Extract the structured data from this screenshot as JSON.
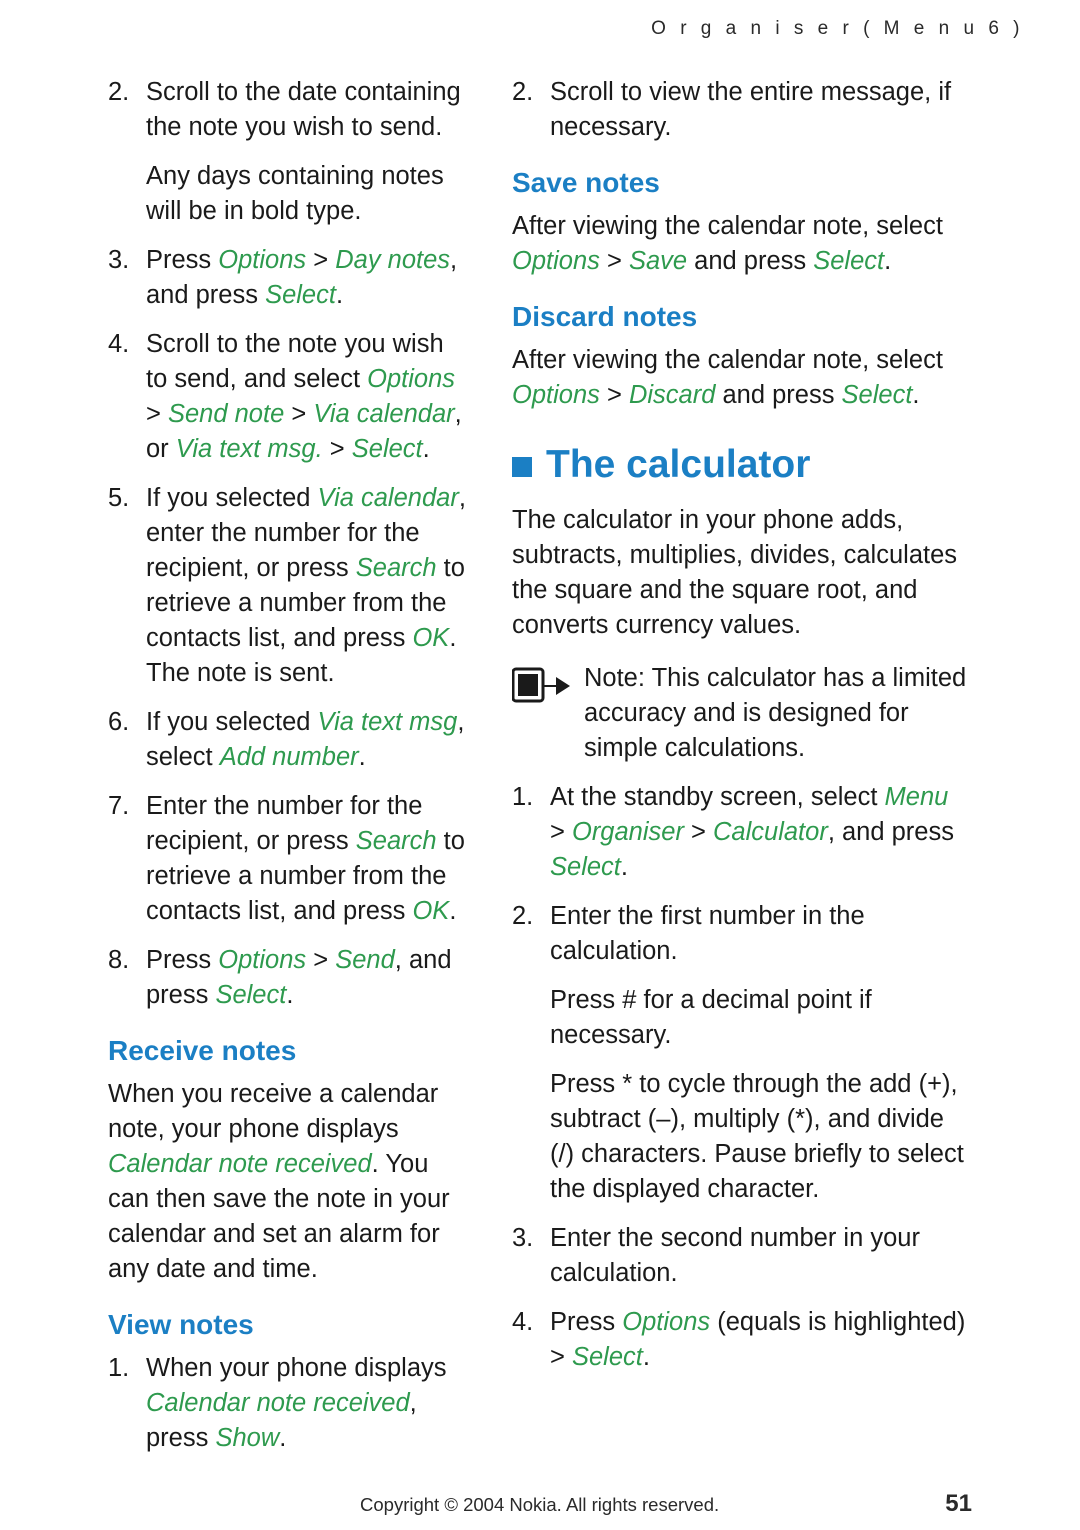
{
  "header": {
    "title": "O r g a n i s e r   ( M e n u   6 )"
  },
  "footer": {
    "copyright": "Copyright © 2004 Nokia. All rights reserved.",
    "page_number": "51"
  },
  "left_column": {
    "items": [
      {
        "num": "2.",
        "text_html": "Scroll to the date containing the note you wish to send."
      },
      {
        "num": "",
        "text_html": "Any days containing notes will be in bold type."
      },
      {
        "num": "3.",
        "text_html": "Press <i class='green'>Options</i> &gt; <i class='green'>Day notes</i>, and press <i class='green'>Select</i>."
      },
      {
        "num": "4.",
        "text_html": "Scroll to the note you wish to send, and select <i class='green'>Options</i> &gt; <i class='green'>Send note</i> &gt; <i class='green'>Via calendar</i>, or <i class='green'>Via text msg.</i> &gt; <i class='green'>Select</i>."
      },
      {
        "num": "5.",
        "text_html": "If you selected <i class='green'>Via calendar</i>, enter the number for the recipient, or press <i class='green'>Search</i> to retrieve a number from the contacts list, and press <i class='green'>OK</i>. The note is sent."
      },
      {
        "num": "6.",
        "text_html": "If you selected <i class='green'>Via text msg</i>, select <i class='green'>Add number</i>."
      },
      {
        "num": "7.",
        "text_html": "Enter the number for the recipient, or press <i class='green'>Search</i> to retrieve a number from the contacts list, and press <i class='green'>OK</i>."
      },
      {
        "num": "8.",
        "text_html": "Press <i class='green'>Options</i> &gt; <i class='green'>Send</i>, and press <i class='green'>Select</i>."
      }
    ],
    "receive_notes": {
      "heading": "Receive notes",
      "text_html": "When you receive a calendar note, your phone displays <i class='green'>Calendar note received</i>. You can then save the note in your calendar and set an alarm for any date and time."
    },
    "view_notes": {
      "heading": "View notes",
      "items": [
        {
          "num": "1.",
          "text_html": "When your phone displays <i class='green'>Calendar note received</i>, press <i class='green'>Show</i>."
        }
      ]
    }
  },
  "right_column": {
    "items_top": [
      {
        "num": "2.",
        "text_html": "Scroll to view the entire message, if necessary."
      }
    ],
    "save_notes": {
      "heading": "Save notes",
      "text_html": "After viewing the calendar note, select <i class='green'>Options</i> &gt; <i class='green'>Save</i> and press <i class='green'>Select</i>."
    },
    "discard_notes": {
      "heading": "Discard notes",
      "text_html": "After viewing the calendar note, select <i class='green'>Options</i> &gt; <i class='green'>Discard</i> and press <i class='green'>Select</i>."
    },
    "calculator": {
      "heading": "The calculator",
      "intro_html": "The calculator in your phone adds, subtracts, multiplies, divides, calculates the square and the square root, and converts currency values.",
      "note_icon_name": "note-hand-icon",
      "note_html": "<b style='font-weight:normal'>Note:</b> This calculator has a limited accuracy and is designed for simple calculations.",
      "items": [
        {
          "num": "1.",
          "text_html": "At the standby screen, select <i class='green'>Menu</i> &gt; <i class='green'>Organiser</i> &gt; <i class='green'>Calculator</i>, and press <i class='green'>Select</i>."
        },
        {
          "num": "2.",
          "text_html": "Enter the first number in the calculation."
        },
        {
          "num": "",
          "text_html": "Press <b style='font-weight:normal'>#</b> for a decimal point if necessary."
        },
        {
          "num": "",
          "text_html": "Press <b style='font-weight:normal'>*</b> to cycle through the add (+), subtract (–), multiply (*), and divide (/) characters. Pause briefly to select the displayed character."
        },
        {
          "num": "3.",
          "text_html": "Enter the second number in your calculation."
        },
        {
          "num": "4.",
          "text_html": "Press <i class='green'>Options</i> (equals is highlighted) &gt; <i class='green'>Select</i>."
        }
      ]
    }
  },
  "colors": {
    "accent_blue": "#1b7fc4",
    "accent_green": "#2e9a4e",
    "text": "#1a1a1a"
  }
}
